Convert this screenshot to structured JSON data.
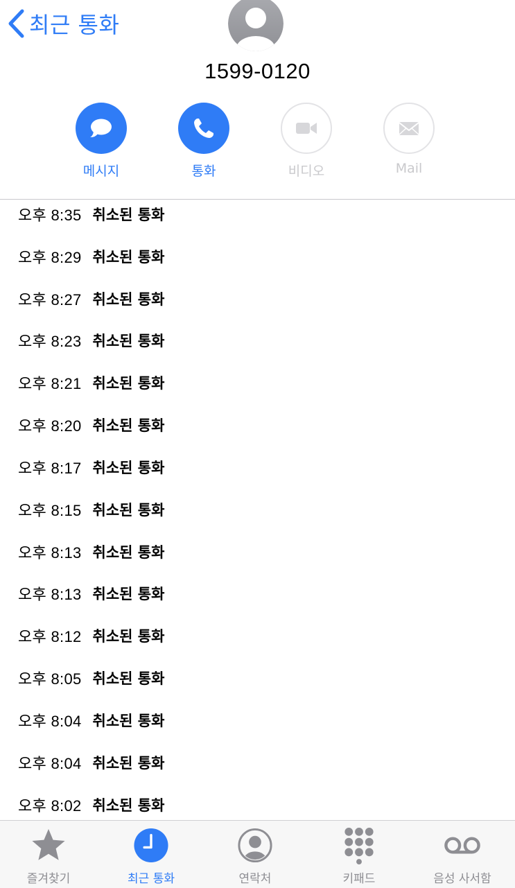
{
  "nav": {
    "back_label": "최근 통화"
  },
  "contact": {
    "phone_number": "1599-0120"
  },
  "actions": [
    {
      "label": "메시지",
      "icon": "message-bubble-icon",
      "enabled": true
    },
    {
      "label": "통화",
      "icon": "phone-icon",
      "enabled": true
    },
    {
      "label": "비디오",
      "icon": "video-camera-icon",
      "enabled": false
    },
    {
      "label": "Mail",
      "icon": "envelope-icon",
      "enabled": false
    }
  ],
  "calls": [
    {
      "time": "오후 8:35",
      "status": "취소된 통화"
    },
    {
      "time": "오후 8:29",
      "status": "취소된 통화"
    },
    {
      "time": "오후 8:27",
      "status": "취소된 통화"
    },
    {
      "time": "오후 8:23",
      "status": "취소된 통화"
    },
    {
      "time": "오후 8:21",
      "status": "취소된 통화"
    },
    {
      "time": "오후 8:20",
      "status": "취소된 통화"
    },
    {
      "time": "오후 8:17",
      "status": "취소된 통화"
    },
    {
      "time": "오후 8:15",
      "status": "취소된 통화"
    },
    {
      "time": "오후 8:13",
      "status": "취소된 통화"
    },
    {
      "time": "오후 8:13",
      "status": "취소된 통화"
    },
    {
      "time": "오후 8:12",
      "status": "취소된 통화"
    },
    {
      "time": "오후 8:05",
      "status": "취소된 통화"
    },
    {
      "time": "오후 8:04",
      "status": "취소된 통화"
    },
    {
      "time": "오후 8:04",
      "status": "취소된 통화"
    },
    {
      "time": "오후 8:02",
      "status": "취소된 통화"
    }
  ],
  "tabs": [
    {
      "label": "즐겨찾기",
      "icon": "star-icon",
      "active": false
    },
    {
      "label": "최근 통화",
      "icon": "clock-icon",
      "active": true
    },
    {
      "label": "연락처",
      "icon": "contacts-icon",
      "active": false
    },
    {
      "label": "키패드",
      "icon": "keypad-icon",
      "active": false
    },
    {
      "label": "음성 사서함",
      "icon": "voicemail-icon",
      "active": false
    }
  ],
  "colors": {
    "accent": "#2f7cf6",
    "inactive": "#8e8e93",
    "disabled": "#c9c9cc",
    "avatar": "#a4a5aa"
  }
}
